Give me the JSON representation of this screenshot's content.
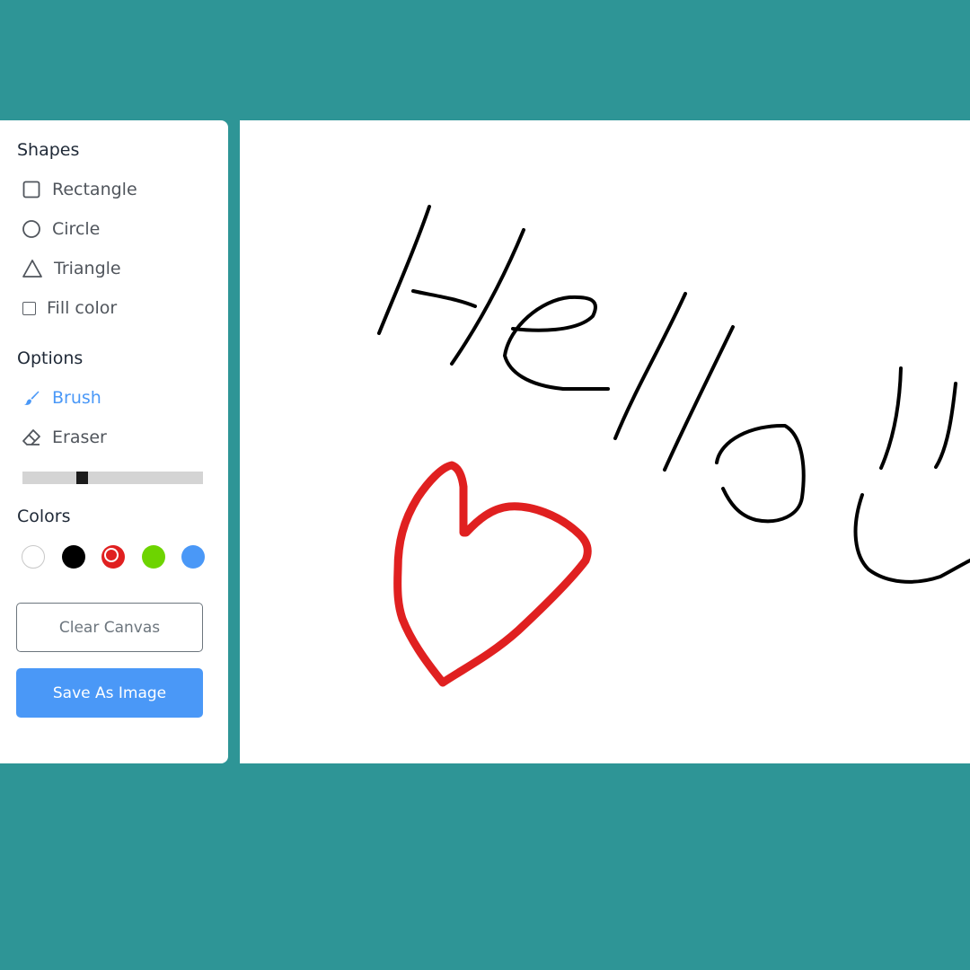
{
  "sidebar": {
    "shapes": {
      "title": "Shapes",
      "items": [
        {
          "label": "Rectangle",
          "icon": "square-outline-icon"
        },
        {
          "label": "Circle",
          "icon": "circle-outline-icon"
        },
        {
          "label": "Triangle",
          "icon": "triangle-outline-icon"
        }
      ],
      "fill_color_label": "Fill color",
      "fill_color_checked": false
    },
    "options": {
      "title": "Options",
      "items": [
        {
          "label": "Brush",
          "icon": "brush-icon",
          "active": true
        },
        {
          "label": "Eraser",
          "icon": "eraser-icon",
          "active": false
        }
      ],
      "brush_size_fraction": 0.32
    },
    "colors": {
      "title": "Colors",
      "swatches": [
        "#ffffff",
        "#000000",
        "#e02020",
        "#6dd400",
        "#4a98f7"
      ],
      "selected_index": 2
    },
    "buttons": {
      "clear_label": "Clear Canvas",
      "save_label": "Save As Image"
    }
  },
  "theme": {
    "background": "#2e9596",
    "accent": "#4a98f7"
  }
}
